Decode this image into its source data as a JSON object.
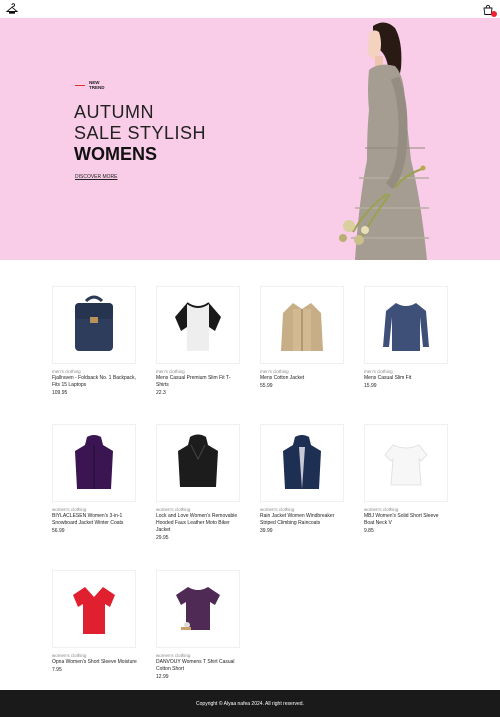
{
  "header": {
    "logo_icon": "hanger-logo-icon",
    "cart_icon": "cart-icon",
    "cart_badge": ""
  },
  "hero": {
    "tag": "NEW TREND",
    "line1": "AUTUMN",
    "line2": "SALE STYLISH",
    "line3": "WOMENS",
    "cta": "DISCOVER MORE",
    "background": "#f9cce8"
  },
  "products": [
    {
      "category": "men's clothing",
      "title": "Fjallraven - Foldsack No. 1 Backpack, Fits 15 Laptops",
      "price": "109.95",
      "image": "backpack"
    },
    {
      "category": "men's clothing",
      "title": "Mens Casual Premium Slim Fit T-Shirts",
      "price": "22.3",
      "image": "raglan-tee"
    },
    {
      "category": "men's clothing",
      "title": "Mens Cotton Jacket",
      "price": "55.99",
      "image": "cotton-jacket"
    },
    {
      "category": "men's clothing",
      "title": "Mens Casual Slim Fit",
      "price": "15.99",
      "image": "longsleeve"
    },
    {
      "category": "women's clothing",
      "title": "BIYLACLESEN Women's 3-in-1 Snowboard Jacket Winter Coats",
      "price": "56.99",
      "image": "purple-jacket"
    },
    {
      "category": "women's clothing",
      "title": "Lock and Love Women's Removable Hooded Faux Leather Moto Biker Jacket",
      "price": "29.95",
      "image": "leather-jacket"
    },
    {
      "category": "women's clothing",
      "title": "Rain Jacket Women Windbreaker Striped Climbing Raincoats",
      "price": "39.99",
      "image": "rain-jacket"
    },
    {
      "category": "women's clothing",
      "title": "MBJ Women's Solid Short Sleeve Boat Neck V",
      "price": "9.85",
      "image": "white-top"
    },
    {
      "category": "women's clothing",
      "title": "Opna Women's Short Sleeve Moisture",
      "price": "7.95",
      "image": "red-vneck"
    },
    {
      "category": "women's clothing",
      "title": "DANVOUY Womens T Shirt Casual Cotton Short",
      "price": "12.99",
      "image": "purple-tee"
    }
  ],
  "footer": {
    "text": "Copyright © Alyaa nafea 2024. All right reserved."
  }
}
